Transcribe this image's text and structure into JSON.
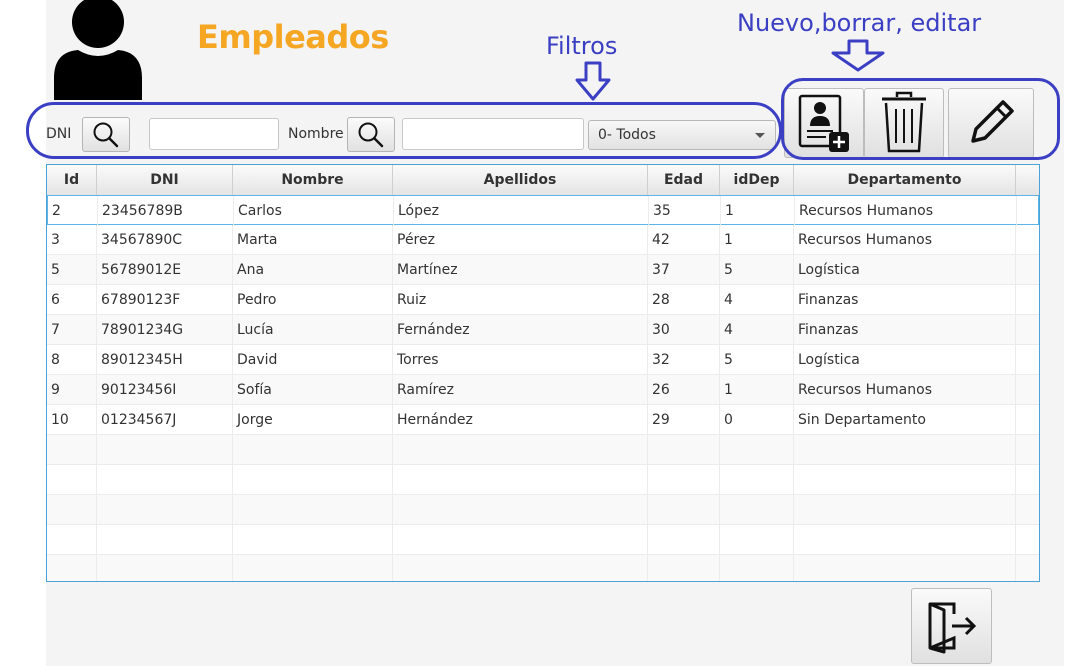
{
  "header": {
    "title": "Empleados"
  },
  "annotations": {
    "filters": "Filtros",
    "actions": "Nuevo,borrar, editar"
  },
  "filters": {
    "dni_label": "DNI",
    "dni_value": "",
    "nombre_label": "Nombre",
    "nombre_value": "",
    "department_selected": "0- Todos"
  },
  "icons": {
    "avatar": "user-avatar-icon",
    "search": "search-icon",
    "new": "add-contact-icon",
    "delete": "trash-icon",
    "edit": "pencil-icon",
    "exit": "exit-door-icon"
  },
  "colors": {
    "title": "#f5a623",
    "annotation": "#3b3fc4",
    "selection": "#5fb4e6"
  },
  "table": {
    "columns": [
      "Id",
      "DNI",
      "Nombre",
      "Apellidos",
      "Edad",
      "idDep",
      "Departamento"
    ],
    "rows": [
      [
        "2",
        "23456789B",
        "Carlos",
        "López",
        "35",
        "1",
        "Recursos Humanos"
      ],
      [
        "3",
        "34567890C",
        "Marta",
        "Pérez",
        "42",
        "1",
        "Recursos Humanos"
      ],
      [
        "5",
        "56789012E",
        "Ana",
        "Martínez",
        "37",
        "5",
        "Logística"
      ],
      [
        "6",
        "67890123F",
        "Pedro",
        "Ruiz",
        "28",
        "4",
        "Finanzas"
      ],
      [
        "7",
        "78901234G",
        "Lucía",
        "Fernández",
        "30",
        "4",
        "Finanzas"
      ],
      [
        "8",
        "89012345H",
        "David",
        "Torres",
        "32",
        "5",
        "Logística"
      ],
      [
        "9",
        "90123456I",
        "Sofía",
        "Ramírez",
        "26",
        "1",
        "Recursos Humanos"
      ],
      [
        "10",
        "01234567J",
        "Jorge",
        "Hernández",
        "29",
        "0",
        "Sin Departamento"
      ]
    ]
  }
}
